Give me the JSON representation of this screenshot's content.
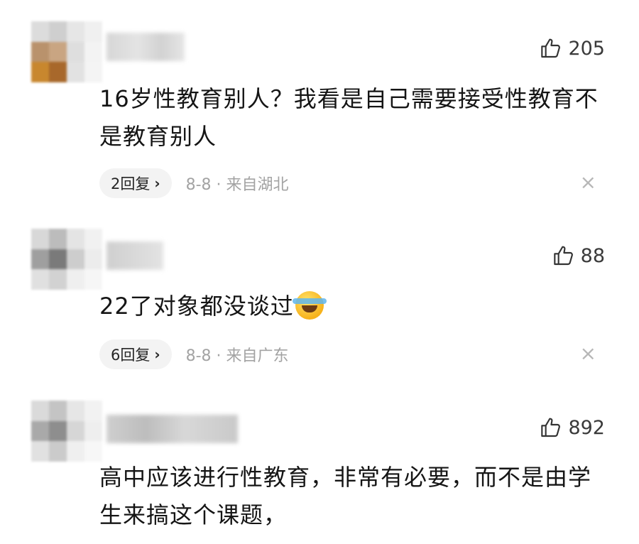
{
  "comments": [
    {
      "likes": "205",
      "text": "16岁性教育别人？我看是自己需要接受性教育不是教育别人",
      "reply_label": "2回复",
      "meta": "8-8 · 来自湖北",
      "close": "×"
    },
    {
      "likes": "88",
      "text": "22了对象都没谈过",
      "emoji": "crying-laughing-emoji",
      "reply_label": "6回复",
      "meta": "8-8 · 来自广东",
      "close": "×"
    },
    {
      "likes": "892",
      "text": "高中应该进行性教育，非常有必要，而不是由学生来搞这个课题，"
    }
  ],
  "icons": {
    "like": "thumbs-up-icon",
    "reply_chevron": "chevron-right-icon",
    "close": "close-icon"
  },
  "reply_chevron": "›"
}
